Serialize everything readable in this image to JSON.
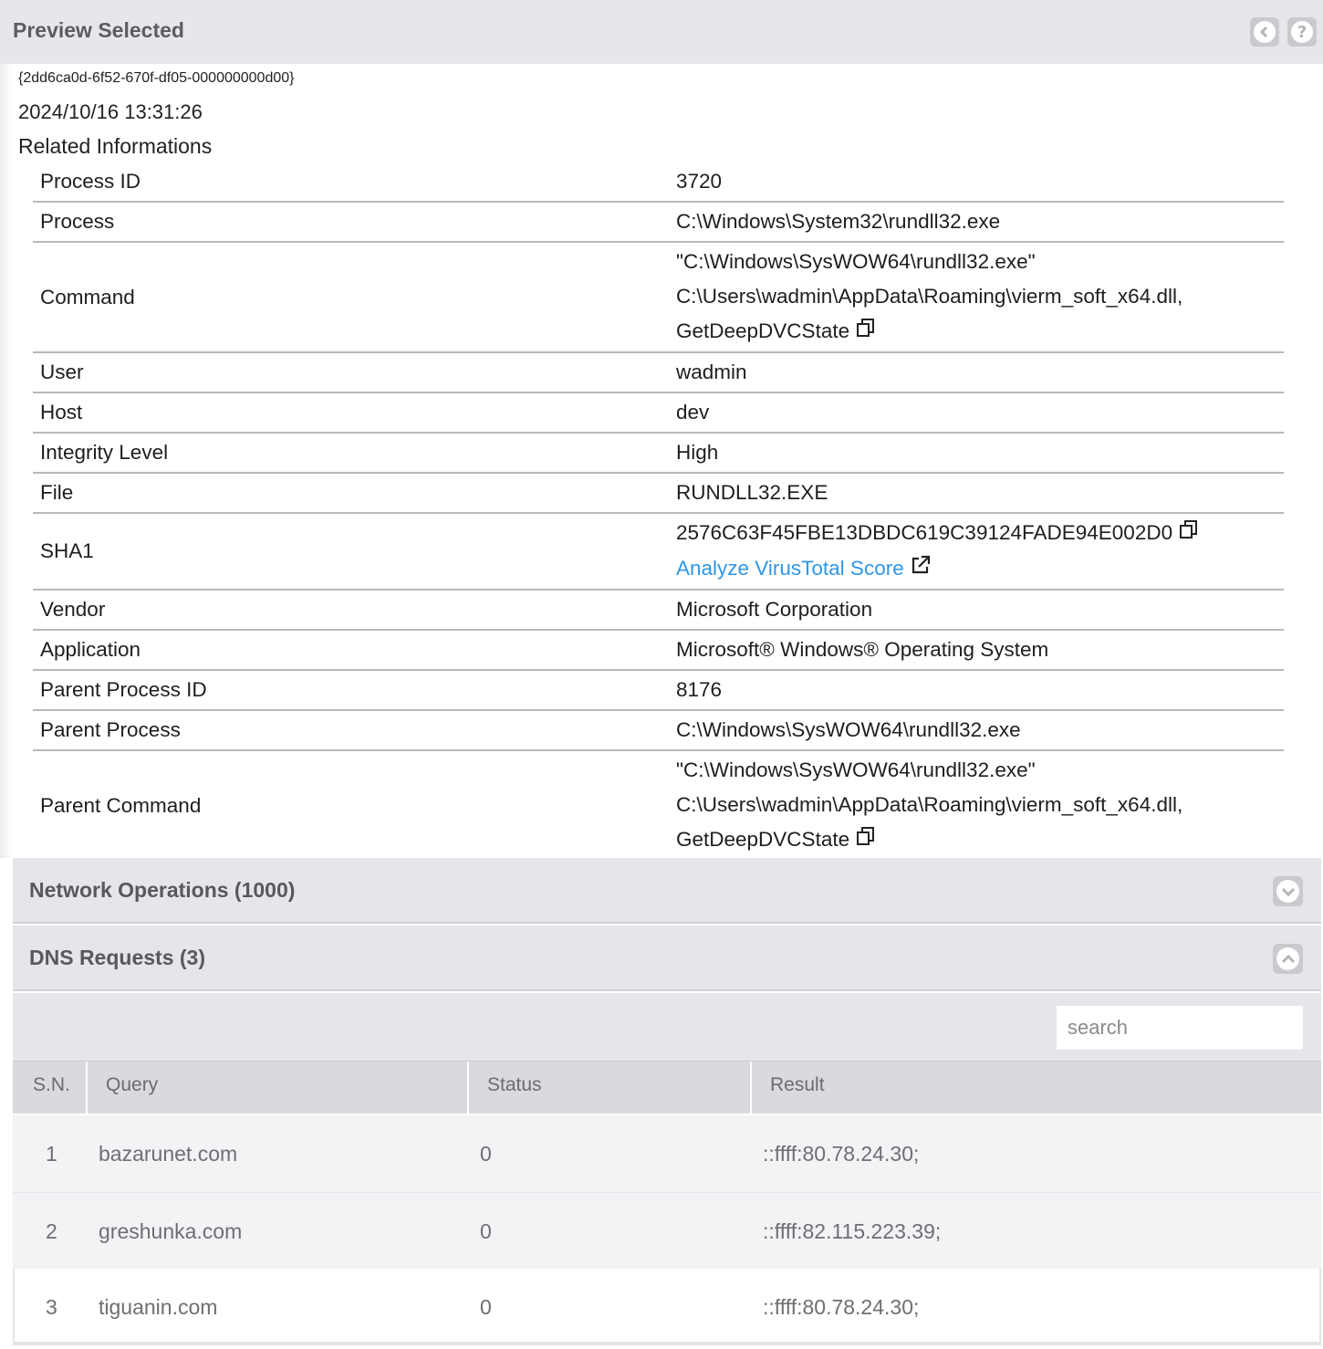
{
  "header": {
    "title": "Preview Selected",
    "back_icon": "chevron-left-icon",
    "help_icon": "help-icon"
  },
  "event": {
    "guid": "{2dd6ca0d-6f52-670f-df05-000000000d00}",
    "timestamp": "2024/10/16 13:31:26",
    "related_heading": "Related Informations"
  },
  "info": {
    "rows": [
      {
        "key": "Process ID",
        "value": "3720"
      },
      {
        "key": "Process",
        "value": "C:\\Windows\\System32\\rundll32.exe"
      },
      {
        "key": "Command",
        "lines": [
          "\"C:\\Windows\\SysWOW64\\rundll32.exe\"",
          "C:\\Users\\wadmin\\AppData\\Roaming\\vierm_soft_x64.dll,",
          "GetDeepDVCState"
        ]
      },
      {
        "key": "User",
        "value": "wadmin"
      },
      {
        "key": "Host",
        "value": "dev"
      },
      {
        "key": "Integrity Level",
        "value": "High"
      },
      {
        "key": "File",
        "value": "RUNDLL32.EXE"
      },
      {
        "key": "SHA1",
        "value": "2576C63F45FBE13DBDC619C39124FADE94E002D0",
        "link": "Analyze VirusTotal Score"
      },
      {
        "key": "Vendor",
        "value": "Microsoft Corporation"
      },
      {
        "key": "Application",
        "value": "Microsoft® Windows® Operating System"
      },
      {
        "key": "Parent Process ID",
        "value": "8176"
      },
      {
        "key": "Parent Process",
        "value": "C:\\Windows\\SysWOW64\\rundll32.exe"
      },
      {
        "key": "Parent Command",
        "lines": [
          "\"C:\\Windows\\SysWOW64\\rundll32.exe\"",
          "C:\\Users\\wadmin\\AppData\\Roaming\\vierm_soft_x64.dll,",
          "GetDeepDVCState"
        ]
      }
    ]
  },
  "sections": {
    "network": {
      "title": "Network Operations (1000)",
      "state": "collapsed",
      "icon": "chevron-down-icon"
    },
    "dns": {
      "title": "DNS Requests (3)",
      "state": "expanded",
      "icon": "chevron-up-icon"
    }
  },
  "dns_table": {
    "search_placeholder": "search",
    "columns": [
      "S.N.",
      "Query",
      "Status",
      "Result"
    ],
    "rows": [
      {
        "sn": "1",
        "query": "bazarunet.com",
        "status": "0",
        "result": "::ffff:80.78.24.30;"
      },
      {
        "sn": "2",
        "query": "greshunka.com",
        "status": "0",
        "result": "::ffff:82.115.223.39;"
      },
      {
        "sn": "3",
        "query": "tiguanin.com",
        "status": "0",
        "result": "::ffff:80.78.24.30;"
      }
    ]
  },
  "colors": {
    "link": "#2f96e8",
    "header_bg": "#e6e6eb",
    "row_alt": "#f3f3f5"
  }
}
